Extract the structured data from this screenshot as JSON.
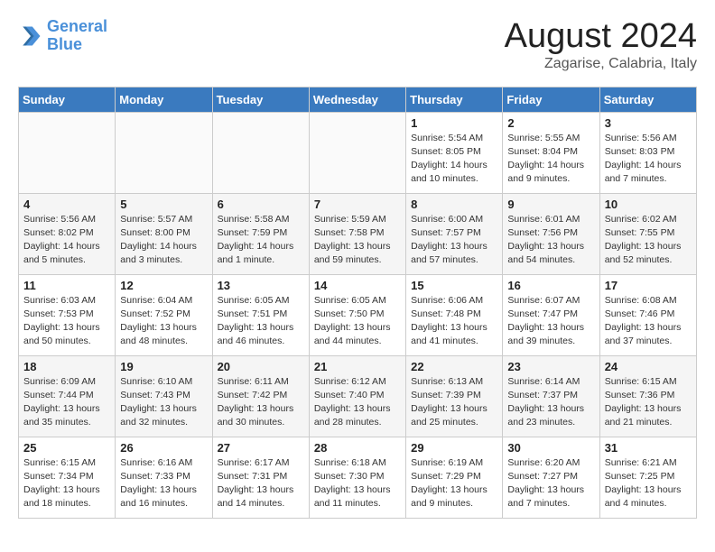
{
  "header": {
    "logo_line1": "General",
    "logo_line2": "Blue",
    "month_year": "August 2024",
    "location": "Zagarise, Calabria, Italy"
  },
  "days_of_week": [
    "Sunday",
    "Monday",
    "Tuesday",
    "Wednesday",
    "Thursday",
    "Friday",
    "Saturday"
  ],
  "weeks": [
    [
      {
        "num": "",
        "info": ""
      },
      {
        "num": "",
        "info": ""
      },
      {
        "num": "",
        "info": ""
      },
      {
        "num": "",
        "info": ""
      },
      {
        "num": "1",
        "info": "Sunrise: 5:54 AM\nSunset: 8:05 PM\nDaylight: 14 hours\nand 10 minutes."
      },
      {
        "num": "2",
        "info": "Sunrise: 5:55 AM\nSunset: 8:04 PM\nDaylight: 14 hours\nand 9 minutes."
      },
      {
        "num": "3",
        "info": "Sunrise: 5:56 AM\nSunset: 8:03 PM\nDaylight: 14 hours\nand 7 minutes."
      }
    ],
    [
      {
        "num": "4",
        "info": "Sunrise: 5:56 AM\nSunset: 8:02 PM\nDaylight: 14 hours\nand 5 minutes."
      },
      {
        "num": "5",
        "info": "Sunrise: 5:57 AM\nSunset: 8:00 PM\nDaylight: 14 hours\nand 3 minutes."
      },
      {
        "num": "6",
        "info": "Sunrise: 5:58 AM\nSunset: 7:59 PM\nDaylight: 14 hours\nand 1 minute."
      },
      {
        "num": "7",
        "info": "Sunrise: 5:59 AM\nSunset: 7:58 PM\nDaylight: 13 hours\nand 59 minutes."
      },
      {
        "num": "8",
        "info": "Sunrise: 6:00 AM\nSunset: 7:57 PM\nDaylight: 13 hours\nand 57 minutes."
      },
      {
        "num": "9",
        "info": "Sunrise: 6:01 AM\nSunset: 7:56 PM\nDaylight: 13 hours\nand 54 minutes."
      },
      {
        "num": "10",
        "info": "Sunrise: 6:02 AM\nSunset: 7:55 PM\nDaylight: 13 hours\nand 52 minutes."
      }
    ],
    [
      {
        "num": "11",
        "info": "Sunrise: 6:03 AM\nSunset: 7:53 PM\nDaylight: 13 hours\nand 50 minutes."
      },
      {
        "num": "12",
        "info": "Sunrise: 6:04 AM\nSunset: 7:52 PM\nDaylight: 13 hours\nand 48 minutes."
      },
      {
        "num": "13",
        "info": "Sunrise: 6:05 AM\nSunset: 7:51 PM\nDaylight: 13 hours\nand 46 minutes."
      },
      {
        "num": "14",
        "info": "Sunrise: 6:05 AM\nSunset: 7:50 PM\nDaylight: 13 hours\nand 44 minutes."
      },
      {
        "num": "15",
        "info": "Sunrise: 6:06 AM\nSunset: 7:48 PM\nDaylight: 13 hours\nand 41 minutes."
      },
      {
        "num": "16",
        "info": "Sunrise: 6:07 AM\nSunset: 7:47 PM\nDaylight: 13 hours\nand 39 minutes."
      },
      {
        "num": "17",
        "info": "Sunrise: 6:08 AM\nSunset: 7:46 PM\nDaylight: 13 hours\nand 37 minutes."
      }
    ],
    [
      {
        "num": "18",
        "info": "Sunrise: 6:09 AM\nSunset: 7:44 PM\nDaylight: 13 hours\nand 35 minutes."
      },
      {
        "num": "19",
        "info": "Sunrise: 6:10 AM\nSunset: 7:43 PM\nDaylight: 13 hours\nand 32 minutes."
      },
      {
        "num": "20",
        "info": "Sunrise: 6:11 AM\nSunset: 7:42 PM\nDaylight: 13 hours\nand 30 minutes."
      },
      {
        "num": "21",
        "info": "Sunrise: 6:12 AM\nSunset: 7:40 PM\nDaylight: 13 hours\nand 28 minutes."
      },
      {
        "num": "22",
        "info": "Sunrise: 6:13 AM\nSunset: 7:39 PM\nDaylight: 13 hours\nand 25 minutes."
      },
      {
        "num": "23",
        "info": "Sunrise: 6:14 AM\nSunset: 7:37 PM\nDaylight: 13 hours\nand 23 minutes."
      },
      {
        "num": "24",
        "info": "Sunrise: 6:15 AM\nSunset: 7:36 PM\nDaylight: 13 hours\nand 21 minutes."
      }
    ],
    [
      {
        "num": "25",
        "info": "Sunrise: 6:15 AM\nSunset: 7:34 PM\nDaylight: 13 hours\nand 18 minutes."
      },
      {
        "num": "26",
        "info": "Sunrise: 6:16 AM\nSunset: 7:33 PM\nDaylight: 13 hours\nand 16 minutes."
      },
      {
        "num": "27",
        "info": "Sunrise: 6:17 AM\nSunset: 7:31 PM\nDaylight: 13 hours\nand 14 minutes."
      },
      {
        "num": "28",
        "info": "Sunrise: 6:18 AM\nSunset: 7:30 PM\nDaylight: 13 hours\nand 11 minutes."
      },
      {
        "num": "29",
        "info": "Sunrise: 6:19 AM\nSunset: 7:29 PM\nDaylight: 13 hours\nand 9 minutes."
      },
      {
        "num": "30",
        "info": "Sunrise: 6:20 AM\nSunset: 7:27 PM\nDaylight: 13 hours\nand 7 minutes."
      },
      {
        "num": "31",
        "info": "Sunrise: 6:21 AM\nSunset: 7:25 PM\nDaylight: 13 hours\nand 4 minutes."
      }
    ]
  ]
}
